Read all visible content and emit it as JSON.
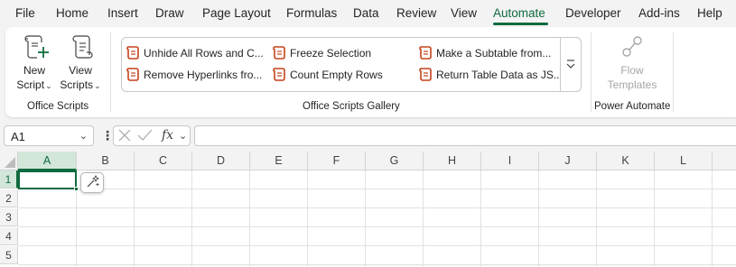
{
  "menu": {
    "tabs": [
      {
        "label": "File"
      },
      {
        "label": "Home"
      },
      {
        "label": "Insert"
      },
      {
        "label": "Draw"
      },
      {
        "label": "Page Layout"
      },
      {
        "label": "Formulas"
      },
      {
        "label": "Data"
      },
      {
        "label": "Review"
      },
      {
        "label": "View"
      },
      {
        "label": "Automate"
      },
      {
        "label": "Developer"
      },
      {
        "label": "Add-ins"
      },
      {
        "label": "Help"
      }
    ],
    "active_tab": "Automate"
  },
  "ribbon": {
    "office_scripts": {
      "new_script_line1": "New",
      "new_script_line2": "Script",
      "view_scripts_line1": "View",
      "view_scripts_line2": "Scripts",
      "group_label": "Office Scripts"
    },
    "gallery": {
      "items": [
        {
          "label": "Unhide All Rows and C..."
        },
        {
          "label": "Freeze Selection"
        },
        {
          "label": "Make a Subtable from..."
        },
        {
          "label": "Remove Hyperlinks fro..."
        },
        {
          "label": "Count Empty Rows"
        },
        {
          "label": "Return Table Data as JS..."
        }
      ],
      "group_label": "Office Scripts Gallery"
    },
    "power_automate": {
      "flow_line1": "Flow",
      "flow_line2": "Templates",
      "group_label": "Power Automate"
    }
  },
  "formula_bar": {
    "name_box": "A1",
    "fx_label": "fx",
    "formula": ""
  },
  "grid": {
    "columns": [
      "A",
      "B",
      "C",
      "D",
      "E",
      "F",
      "G",
      "H",
      "I",
      "J",
      "K",
      "L"
    ],
    "rows": [
      "1",
      "2",
      "3",
      "4",
      "5"
    ],
    "selected_cell": "A1"
  },
  "colors": {
    "accent": "#0f6b3e",
    "script_icon": "#c4421a",
    "disabled": "#a6a6a6"
  }
}
